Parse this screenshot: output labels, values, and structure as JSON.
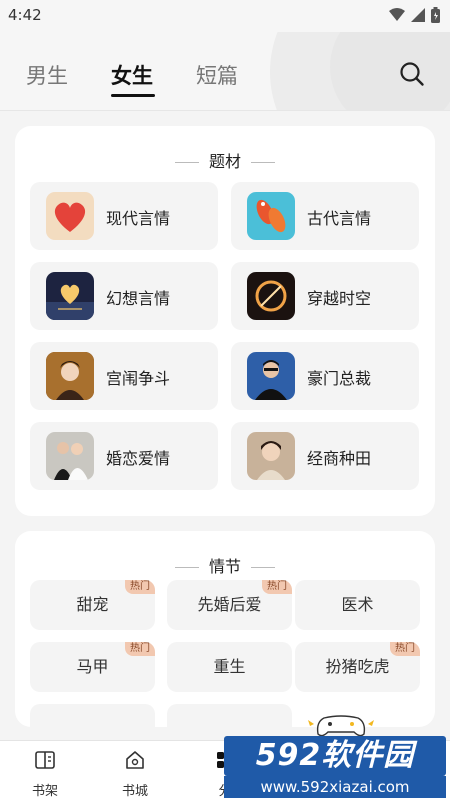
{
  "status": {
    "time": "4:42"
  },
  "tabs": [
    {
      "label": "男生",
      "active": false
    },
    {
      "label": "女生",
      "active": true
    },
    {
      "label": "短篇",
      "active": false
    }
  ],
  "genre_section": {
    "title": "题材",
    "items": [
      {
        "label": "现代言情",
        "icon": "heart-icon"
      },
      {
        "label": "古代言情",
        "icon": "koi-fish-icon"
      },
      {
        "label": "幻想言情",
        "icon": "moon-heart-icon"
      },
      {
        "label": "穿越时空",
        "icon": "portal-icon"
      },
      {
        "label": "宫闱争斗",
        "icon": "palace-lady-icon"
      },
      {
        "label": "豪门总裁",
        "icon": "ceo-icon"
      },
      {
        "label": "婚恋爱情",
        "icon": "wedding-couple-icon"
      },
      {
        "label": "经商种田",
        "icon": "merchant-lady-icon"
      }
    ]
  },
  "plot_section": {
    "title": "情节",
    "hot_label": "热门",
    "items": [
      {
        "label": "甜宠",
        "hot": true
      },
      {
        "label": "先婚后爱",
        "hot": true
      },
      {
        "label": "医术",
        "hot": false
      },
      {
        "label": "马甲",
        "hot": true
      },
      {
        "label": "重生",
        "hot": false
      },
      {
        "label": "扮猪吃虎",
        "hot": true
      }
    ]
  },
  "bottom_nav": [
    {
      "label": "书架",
      "icon": "book-icon"
    },
    {
      "label": "书城",
      "icon": "home-icon"
    },
    {
      "label": "分",
      "icon": "category-icon"
    }
  ],
  "watermark": {
    "main": "592软件园",
    "sub": "www.592xiazai.com"
  },
  "colors": {
    "hot_badge_bg": "#f2c8b0",
    "accent": "#111111",
    "watermark_blue": "#1f5aa8"
  }
}
